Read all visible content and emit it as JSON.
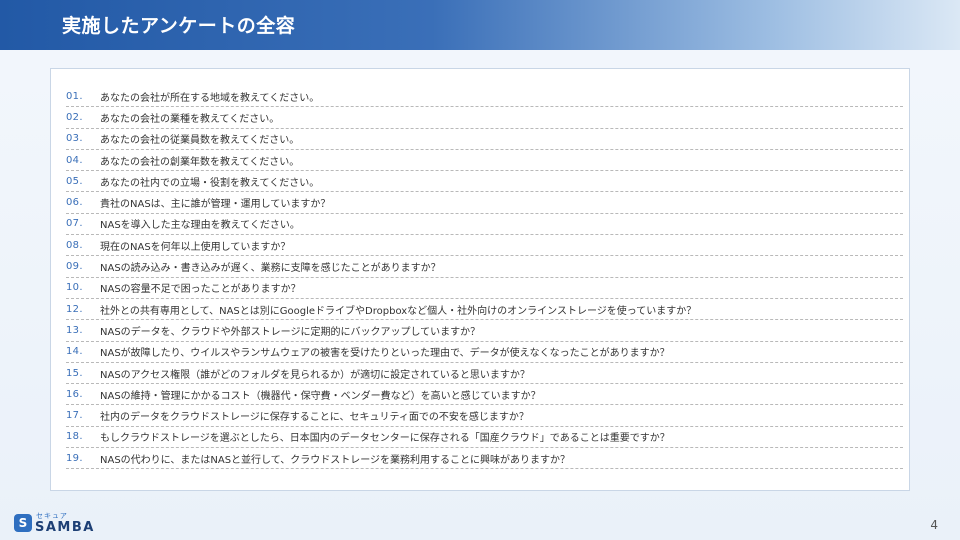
{
  "header": {
    "title": "実施したアンケートの全容"
  },
  "questions": [
    {
      "num": "01.",
      "text": "あなたの会社が所在する地域を教えてください。"
    },
    {
      "num": "02.",
      "text": "あなたの会社の業種を教えてください。"
    },
    {
      "num": "03.",
      "text": "あなたの会社の従業員数を教えてください。"
    },
    {
      "num": "04.",
      "text": "あなたの会社の創業年数を教えてください。"
    },
    {
      "num": "05.",
      "text": "あなたの社内での立場・役割を教えてください。"
    },
    {
      "num": "06.",
      "text": "貴社のNASは、主に誰が管理・運用していますか？"
    },
    {
      "num": "07.",
      "text": "NASを導入した主な理由を教えてください。"
    },
    {
      "num": "08.",
      "text": "現在のNASを何年以上使用していますか？"
    },
    {
      "num": "09.",
      "text": "NASの読み込み・書き込みが遅く、業務に支障を感じたことがありますか？"
    },
    {
      "num": "10.",
      "text": "NASの容量不足で困ったことがありますか？"
    },
    {
      "num": "12.",
      "text": "社外との共有専用として、NASとは別にGoogleドライブやDropboxなど個人・社外向けのオンラインストレージを使っていますか？"
    },
    {
      "num": "13.",
      "text": "NASのデータを、クラウドや外部ストレージに定期的にバックアップしていますか？"
    },
    {
      "num": "14.",
      "text": "NASが故障したり、ウイルスやランサムウェアの被害を受けたりといった理由で、データが使えなくなったことがありますか？"
    },
    {
      "num": "15.",
      "text": "NASのアクセス権限（誰がどのフォルダを見られるか）が適切に設定されていると思いますか？"
    },
    {
      "num": "16.",
      "text": "NASの維持・管理にかかるコスト（機器代・保守費・ベンダー費など）を高いと感じていますか？"
    },
    {
      "num": "17.",
      "text": "社内のデータをクラウドストレージに保存することに、セキュリティ面での不安を感じますか？"
    },
    {
      "num": "18.",
      "text": "もしクラウドストレージを選ぶとしたら、日本国内のデータセンターに保存される「国産クラウド」であることは重要ですか？"
    },
    {
      "num": "19.",
      "text": "NASの代わりに、またはNASと並行して、クラウドストレージを業務利用することに興味がありますか？"
    }
  ],
  "logo": {
    "mark": "S",
    "kana": "セキュア",
    "word": "SAMBA"
  },
  "footer": {
    "page_number": "4"
  },
  "colors": {
    "header_blue": "#2259a6",
    "number_blue": "#3a6fb8",
    "brand_blue": "#2f6fc0"
  }
}
